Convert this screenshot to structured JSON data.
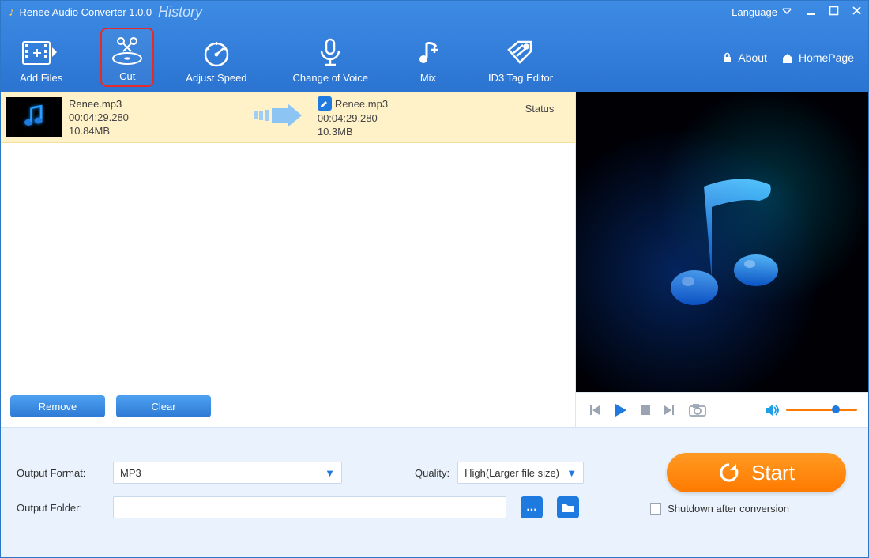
{
  "title": {
    "app": "Renee Audio Converter 1.0.0",
    "history": "History"
  },
  "win": {
    "language": "Language"
  },
  "toolbar": {
    "add_files": "Add Files",
    "cut": "Cut",
    "adjust_speed": "Adjust Speed",
    "change_voice": "Change of Voice",
    "mix": "Mix",
    "id3": "ID3 Tag Editor"
  },
  "links": {
    "about": "About",
    "home": "HomePage"
  },
  "item": {
    "in": {
      "name": "Renee.mp3",
      "dur": "00:04:29.280",
      "size": "10.84MB"
    },
    "out": {
      "name": "Renee.mp3",
      "dur": "00:04:29.280",
      "size": "10.3MB"
    },
    "status_h": "Status",
    "status_v": "-"
  },
  "listbtns": {
    "remove": "Remove",
    "clear": "Clear"
  },
  "bottom": {
    "format_l": "Output Format:",
    "format_v": "MP3",
    "quality_l": "Quality:",
    "quality_v": "High(Larger file size)",
    "folder_l": "Output Folder:",
    "folder_v": "",
    "start": "Start",
    "shutdown": "Shutdown after conversion",
    "browse": "..."
  },
  "colors": {
    "accent": "#1f7ae0",
    "orange": "#ff7a00"
  }
}
